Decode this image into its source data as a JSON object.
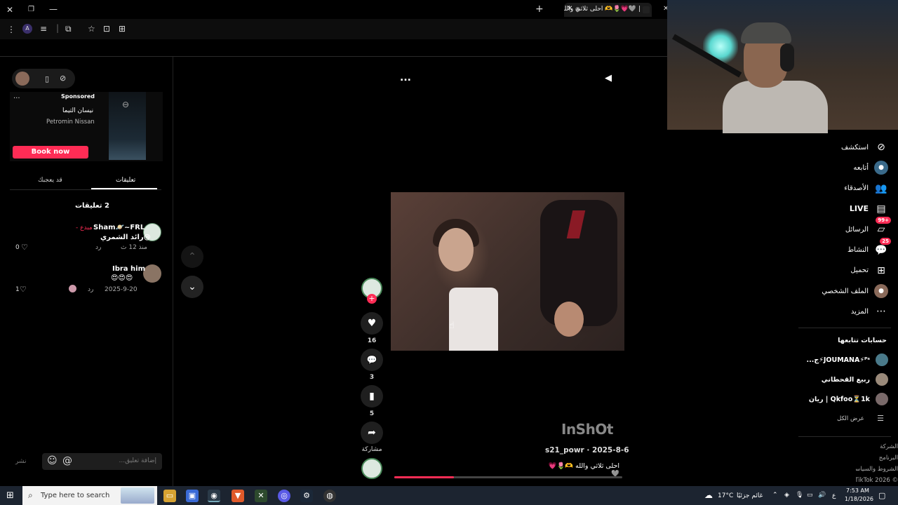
{
  "browser": {
    "tab_title": "احلى ثلاثي والله 🫶🌷💗🩶 |",
    "window_controls": {
      "close": "✕",
      "restore": "❐",
      "minimize": "—"
    },
    "new_tab": "+"
  },
  "left_panel": {
    "ad": {
      "menu": "...",
      "label": "Sponsored",
      "title": "نيسان التيما",
      "advertiser": "Petromin Nissan",
      "cta": "Book now"
    },
    "tabs": [
      {
        "label": "تعليقات"
      },
      {
        "label": "قد يعجبك"
      }
    ],
    "comments_count_label": "2 تعليقات",
    "comments": [
      {
        "name": "Sham🪐~FRL",
        "creator_tag": "مبدع -",
        "text": "@رائد الشمري",
        "meta_time": "منذ 12 ث",
        "reply": "رد",
        "likes": "0"
      },
      {
        "name": "Ibra him",
        "text": "😍😍😍",
        "meta_time": "2025-9-20",
        "reply": "رد",
        "likes": "1"
      }
    ],
    "input_placeholder": "إضافة تعليق...",
    "post_label": "نشر"
  },
  "video": {
    "actions": [
      {
        "name": "like",
        "count": "16"
      },
      {
        "name": "comment",
        "count": "3"
      },
      {
        "name": "save",
        "count": "5"
      },
      {
        "name": "share",
        "count": "مشاركة"
      }
    ],
    "watermark": "InShOt",
    "author": "s21_powr · 2025-8-6",
    "caption": "احلى ثلاثي والله 🫶🌷💗🩶",
    "progress": 0.26,
    "more": "..."
  },
  "right_sidebar": {
    "nav": [
      {
        "label": "استكشف",
        "icon": "compass-icon"
      },
      {
        "label": "أتابعه",
        "icon": "following-icon"
      },
      {
        "label": "الأصدقاء",
        "icon": "friends-icon"
      },
      {
        "label": "LIVE",
        "icon": "live-icon"
      },
      {
        "label": "الرسائل",
        "icon": "messages-icon",
        "badge": "99+"
      },
      {
        "label": "النشاط",
        "icon": "activity-icon",
        "badge": "25"
      },
      {
        "label": "تحميل",
        "icon": "upload-icon"
      },
      {
        "label": "الملف الشخصي",
        "icon": "profile-icon"
      },
      {
        "label": "المزيد",
        "icon": "more-icon"
      }
    ],
    "following_header": "حسابات تتابعها",
    "following": [
      {
        "name": "JOUMANA⚡ᴾˢ⚡ج..."
      },
      {
        "name": "ربيع القحطاني"
      },
      {
        "name": "Qkfoo⏳1k | ريان"
      }
    ],
    "see_all": "عرض الكل",
    "footer": [
      "الشركة",
      "البرنامج",
      "الشروط والسياسات",
      "© 2026 TikTok"
    ]
  },
  "taskbar": {
    "search_placeholder": "Type here to search",
    "weather": "17°C",
    "weather_desc": "غائم جزئيًا",
    "lang": "ع",
    "time": "7:53 AM",
    "date": "1/18/2026"
  }
}
